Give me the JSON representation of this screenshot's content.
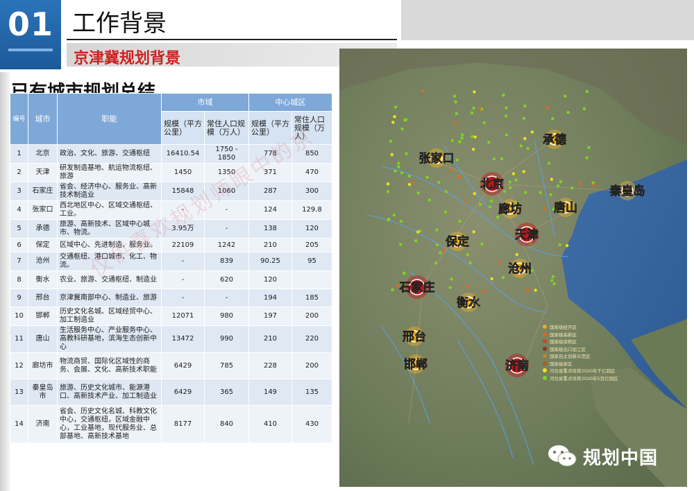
{
  "header": {
    "section_number": "01",
    "title": "工作背景",
    "subtitle": "京津冀规划背景"
  },
  "section_title": "已有城市规划总结",
  "table": {
    "headers": {
      "no": "编号",
      "city": "城市",
      "function": "职能",
      "city_area": "市域",
      "central": "中心城区",
      "area": "规模（平方公里）",
      "population": "常住人口规模（万人）",
      "central_area": "规模（平方公里）",
      "central_population": "常住人口规模（万人）"
    },
    "rows": [
      {
        "no": "1",
        "city": "北京",
        "function": "政治、文化、旅游、交通枢纽",
        "area": "16410.54",
        "pop": "1750 - 1850",
        "c_area": "778",
        "c_pop": "850"
      },
      {
        "no": "2",
        "city": "天津",
        "function": "研发制造基地、航运物流枢纽、旅游",
        "area": "1450",
        "pop": "1350",
        "c_area": "371",
        "c_pop": "470"
      },
      {
        "no": "3",
        "city": "石家庄",
        "function": "省会、经济中心、服务业、高新技术制造业",
        "area": "15848",
        "pop": "1060",
        "c_area": "287",
        "c_pop": "300"
      },
      {
        "no": "4",
        "city": "张家口",
        "function": "西北地区中心、区域交通枢纽、工业。",
        "area": "-",
        "pop": "-",
        "c_area": "124",
        "c_pop": "129.8"
      },
      {
        "no": "5",
        "city": "承德",
        "function": "旅游、高新技术、区域中心城市、物流。",
        "area": "3.95万",
        "pop": "-",
        "c_area": "138",
        "c_pop": "120"
      },
      {
        "no": "6",
        "city": "保定",
        "function": "区域中心、先进制造、服务业。",
        "area": "22109",
        "pop": "1242",
        "c_area": "210",
        "c_pop": "205"
      },
      {
        "no": "7",
        "city": "沧州",
        "function": "交通枢纽、港口城市、化工、物流。",
        "area": "-",
        "pop": "839",
        "c_area": "90.25",
        "c_pop": "95"
      },
      {
        "no": "8",
        "city": "衡水",
        "function": "农业、旅游、交通枢纽、制造业",
        "area": "-",
        "pop": "620",
        "c_area": "120",
        "c_pop": ""
      },
      {
        "no": "9",
        "city": "邢台",
        "function": "京津冀南部中心、制造业、旅游",
        "area": "-",
        "pop": "-",
        "c_area": "194",
        "c_pop": "185"
      },
      {
        "no": "10",
        "city": "邯郸",
        "function": "历史文化名城、区域经贸中心、加工制造业",
        "area": "12071",
        "pop": "980",
        "c_area": "197",
        "c_pop": "200"
      },
      {
        "no": "11",
        "city": "唐山",
        "function": "生活服务中心、产业服务中心、高教科研基地，滨海生态创新中心",
        "area": "13472",
        "pop": "990",
        "c_area": "210",
        "c_pop": "220"
      },
      {
        "no": "12",
        "city": "廊坊市",
        "function": "物流商贸、国际化区域性的商务、会展、文化、高新技术职能",
        "area": "6429",
        "pop": "785",
        "c_area": "228",
        "c_pop": "200"
      },
      {
        "no": "13",
        "city": "秦皇岛市",
        "function": "旅游、历史文化城市、能源港口、高新技术产业、加工制造业",
        "area": "6429",
        "pop": "365",
        "c_area": "149",
        "c_pop": "135"
      },
      {
        "no": "14",
        "city": "济南",
        "function": "省会、历史文化名城、科教文化中心，交通枢纽，区域金融中心，工业基地，现代服务业、总部基地、高新技术基地",
        "area": "8177",
        "pop": "840",
        "c_area": "410",
        "c_pop": "430"
      }
    ]
  },
  "map": {
    "cities": [
      {
        "name": "张家口",
        "style": "yellow"
      },
      {
        "name": "承德",
        "style": "yellow"
      },
      {
        "name": "北京",
        "style": "red"
      },
      {
        "name": "秦皇岛",
        "style": "yellow"
      },
      {
        "name": "廊坊",
        "style": "yellow"
      },
      {
        "name": "唐山",
        "style": "yellow"
      },
      {
        "name": "天津",
        "style": "red"
      },
      {
        "name": "保定",
        "style": "yellow"
      },
      {
        "name": "沧州",
        "style": "yellow"
      },
      {
        "name": "石家庄",
        "style": "red"
      },
      {
        "name": "衡水",
        "style": "yellow"
      },
      {
        "name": "邢台",
        "style": "yellow"
      },
      {
        "name": "邯郸",
        "style": "yellow"
      },
      {
        "name": "济南",
        "style": "red"
      }
    ],
    "legend": [
      {
        "label": "国家级经开区",
        "color": "#e8b020"
      },
      {
        "label": "国家级高新区",
        "color": "#e06a1a"
      },
      {
        "label": "国家级保税区",
        "color": "#c04a2a"
      },
      {
        "label": "国家级出口加工区",
        "color": "#8a3a1a"
      },
      {
        "label": "国家自主创新示范区",
        "color": "#c0862a"
      },
      {
        "label": "国家级新区",
        "color": "#a06020"
      },
      {
        "label": "河北省重点培育2020年千亿园区",
        "color": "#f0e020"
      },
      {
        "label": "河北省重点培育2020年5百亿园区",
        "color": "#7ed321"
      }
    ]
  },
  "watermark": {
    "brand": "规划中国",
    "diagonal": "仅供喜欢规划师眼中的京"
  },
  "colors": {
    "header_blue": "#2b73b8",
    "table_header": "#7ea8d8",
    "subtitle_red": "#d11f1f",
    "city_red": "#c0161b",
    "city_yellow": "#f2b21b"
  }
}
